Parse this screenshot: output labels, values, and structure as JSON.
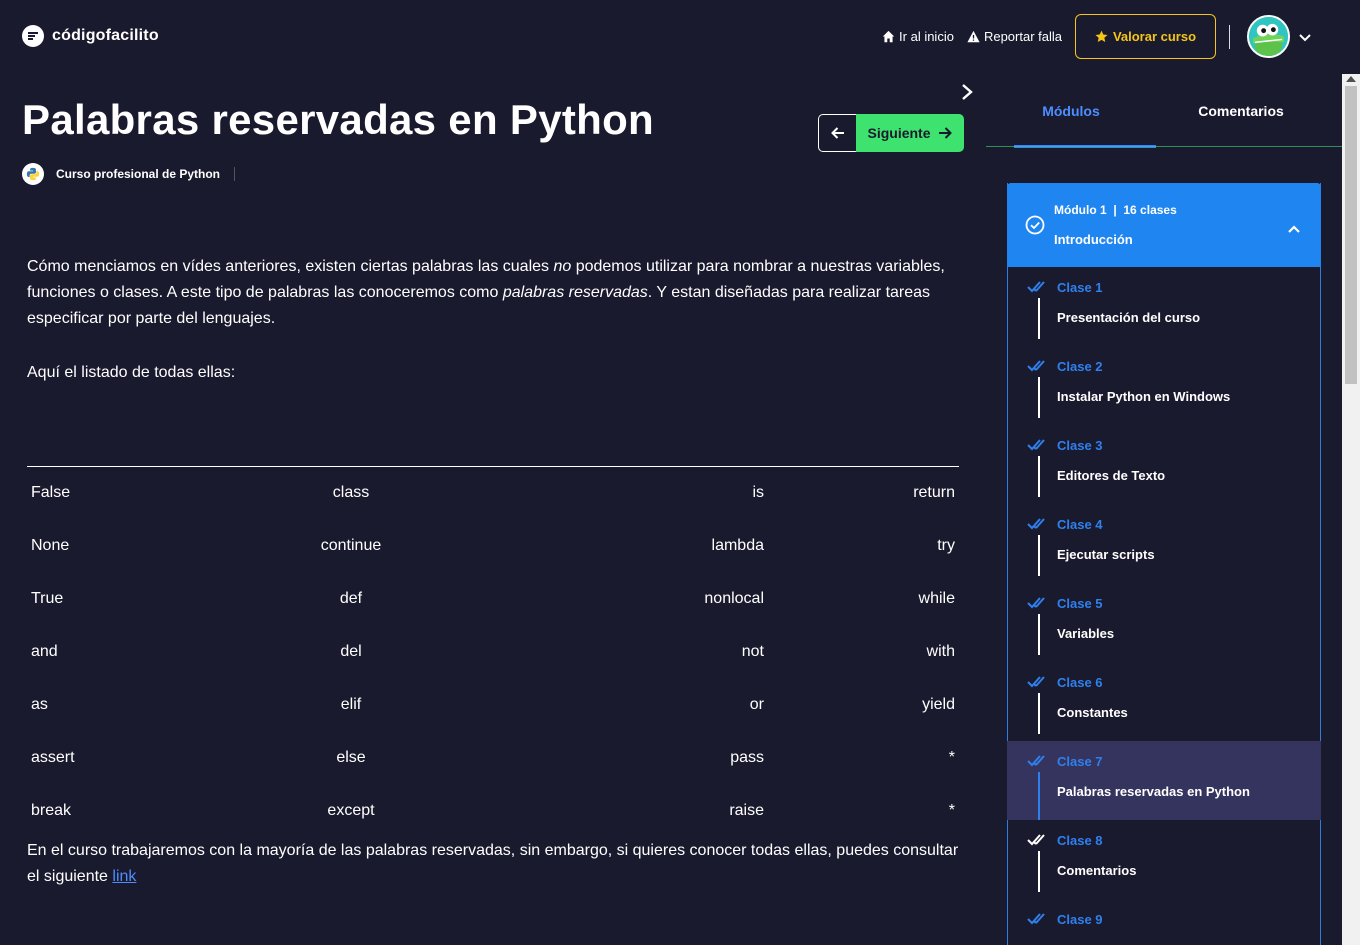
{
  "header": {
    "logo_text": "códigofacilito",
    "nav": {
      "home": "Ir al inicio",
      "report": "Reportar falla",
      "rate": "Valorar curso"
    },
    "avatar_icon": "crocodile-avatar-icon"
  },
  "lesson": {
    "title": "Palabras reservadas en Python",
    "course": "Curso profesional de Python",
    "next_label": "Siguiente"
  },
  "content": {
    "p1": {
      "a": "Cómo menciamos en vídes anteriores, existen ciertas palabras las cuales ",
      "b": "no",
      "c": " podemos utilizar para nombrar a nuestras variables, funciones o clases. A este tipo de palabras las conoceremos como ",
      "d": "palabras reservadas",
      "e": ". Y estan diseñadas para realizar tareas especificar por parte del lenguajes."
    },
    "p2": "Aquí el listado de todas ellas:",
    "table": [
      [
        "False",
        "class",
        "is",
        "return"
      ],
      [
        "None",
        "continue",
        "lambda",
        "try"
      ],
      [
        "True",
        "def",
        "nonlocal",
        "while"
      ],
      [
        "and",
        "del",
        "not",
        "with"
      ],
      [
        "as",
        "elif",
        "or",
        "yield"
      ],
      [
        "assert",
        "else",
        "pass",
        "*"
      ],
      [
        "break",
        "except",
        "raise",
        "*"
      ]
    ],
    "p3": "En el curso trabajaremos con la mayoría de las palabras reservadas, sin embargo, si quieres conocer todas ellas, puedes consultar el siguiente ",
    "link": "link"
  },
  "sidebar": {
    "tabs": [
      "Módulos",
      "Comentarios"
    ],
    "module": {
      "label": "Módulo 1",
      "count": "16 clases",
      "title": "Introducción"
    },
    "lessons": [
      {
        "num": "Clase 1",
        "name": "Presentación del curso"
      },
      {
        "num": "Clase 2",
        "name": "Instalar Python en Windows"
      },
      {
        "num": "Clase 3",
        "name": "Editores de Texto"
      },
      {
        "num": "Clase 4",
        "name": "Ejecutar scripts"
      },
      {
        "num": "Clase 5",
        "name": "Variables"
      },
      {
        "num": "Clase 6",
        "name": "Constantes"
      },
      {
        "num": "Clase 7",
        "name": "Palabras reservadas en Python"
      },
      {
        "num": "Clase 8",
        "name": "Comentarios"
      },
      {
        "num": "Clase 9",
        "name": ""
      }
    ],
    "active_index": 6
  },
  "colors": {
    "background": "#1a1a2e",
    "accent_blue": "#1f85f0",
    "accent_green": "#3ee36f",
    "accent_gold": "#f5c518"
  }
}
